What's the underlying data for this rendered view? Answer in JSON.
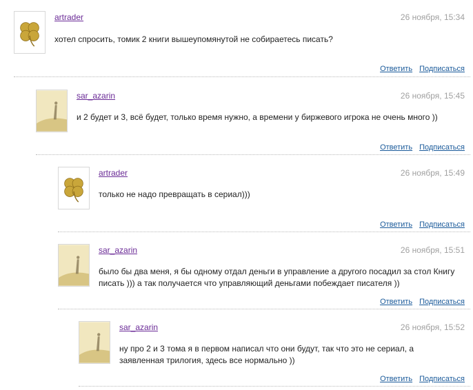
{
  "actions": {
    "reply_label": "Ответить",
    "subscribe_label": "Подписаться"
  },
  "comments": [
    {
      "author": "artrader",
      "date": "26 ноября, 15:34",
      "text": "хотел спросить, томик 2 книги вышеупомянутой не собираетесь писать?",
      "avatar": "clover-icon"
    },
    {
      "author": "sar_azarin",
      "date": "26 ноября, 15:45",
      "text": "и 2 будет и 3, всё будет, только время нужно, а времени у биржевого игрока не очень много ))",
      "avatar": "figure-on-hill-icon"
    },
    {
      "author": "artrader",
      "date": "26 ноября, 15:49",
      "text": "только не надо превращать в сериал)))",
      "avatar": "clover-icon"
    },
    {
      "author": "sar_azarin",
      "date": "26 ноября, 15:51",
      "text": "было бы два меня, я бы одному отдал деньги в управление а другого посадил за стол Книгу писать ))) а так получается что управляющий деньгами побеждает писателя ))",
      "avatar": "figure-on-hill-icon"
    },
    {
      "author": "sar_azarin",
      "date": "26 ноября, 15:52",
      "text": "ну про 2 и 3 тома я в первом написал что они будут, так что это не сериал, а заявленная трилогия, здесь все нормально ))",
      "avatar": "figure-on-hill-icon"
    }
  ],
  "colors": {
    "author_link": "#6a2a96",
    "action_link": "#1a5a9a",
    "date": "#a0a0a0",
    "clover": "#c9a63a"
  }
}
